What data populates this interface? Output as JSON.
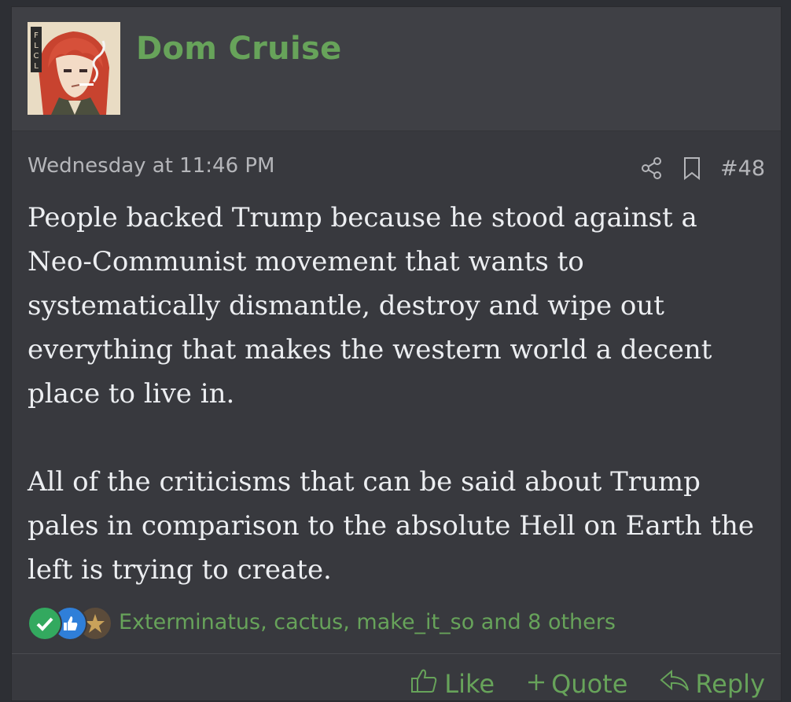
{
  "post": {
    "username": "Dom Cruise",
    "avatar_icon": "anime-avatar",
    "timestamp": "Wednesday at 11:46 PM",
    "post_number": "#48",
    "body": {
      "paragraph1": "People backed Trump because he stood against a Neo-Communist movement that wants to systematically dismantle, destroy and wipe out everything that makes the western world a decent place to live in.",
      "paragraph2": "All of the criticisms that can be said about Trump pales in comparison to the absolute Hell on Earth the left is trying to create."
    },
    "reactions": {
      "text": "Exterminatus, cactus, make_it_so and 8 others",
      "icons": [
        "check-reaction-icon",
        "like-reaction-icon",
        "emblem-reaction-icon"
      ]
    },
    "actions": {
      "like": "Like",
      "quote": "Quote",
      "reply": "Reply"
    }
  },
  "colors": {
    "accent": "#67a35a",
    "background": "#38393e",
    "header": "#3f4045",
    "text": "#eceef1",
    "muted": "#b5b6ba"
  }
}
